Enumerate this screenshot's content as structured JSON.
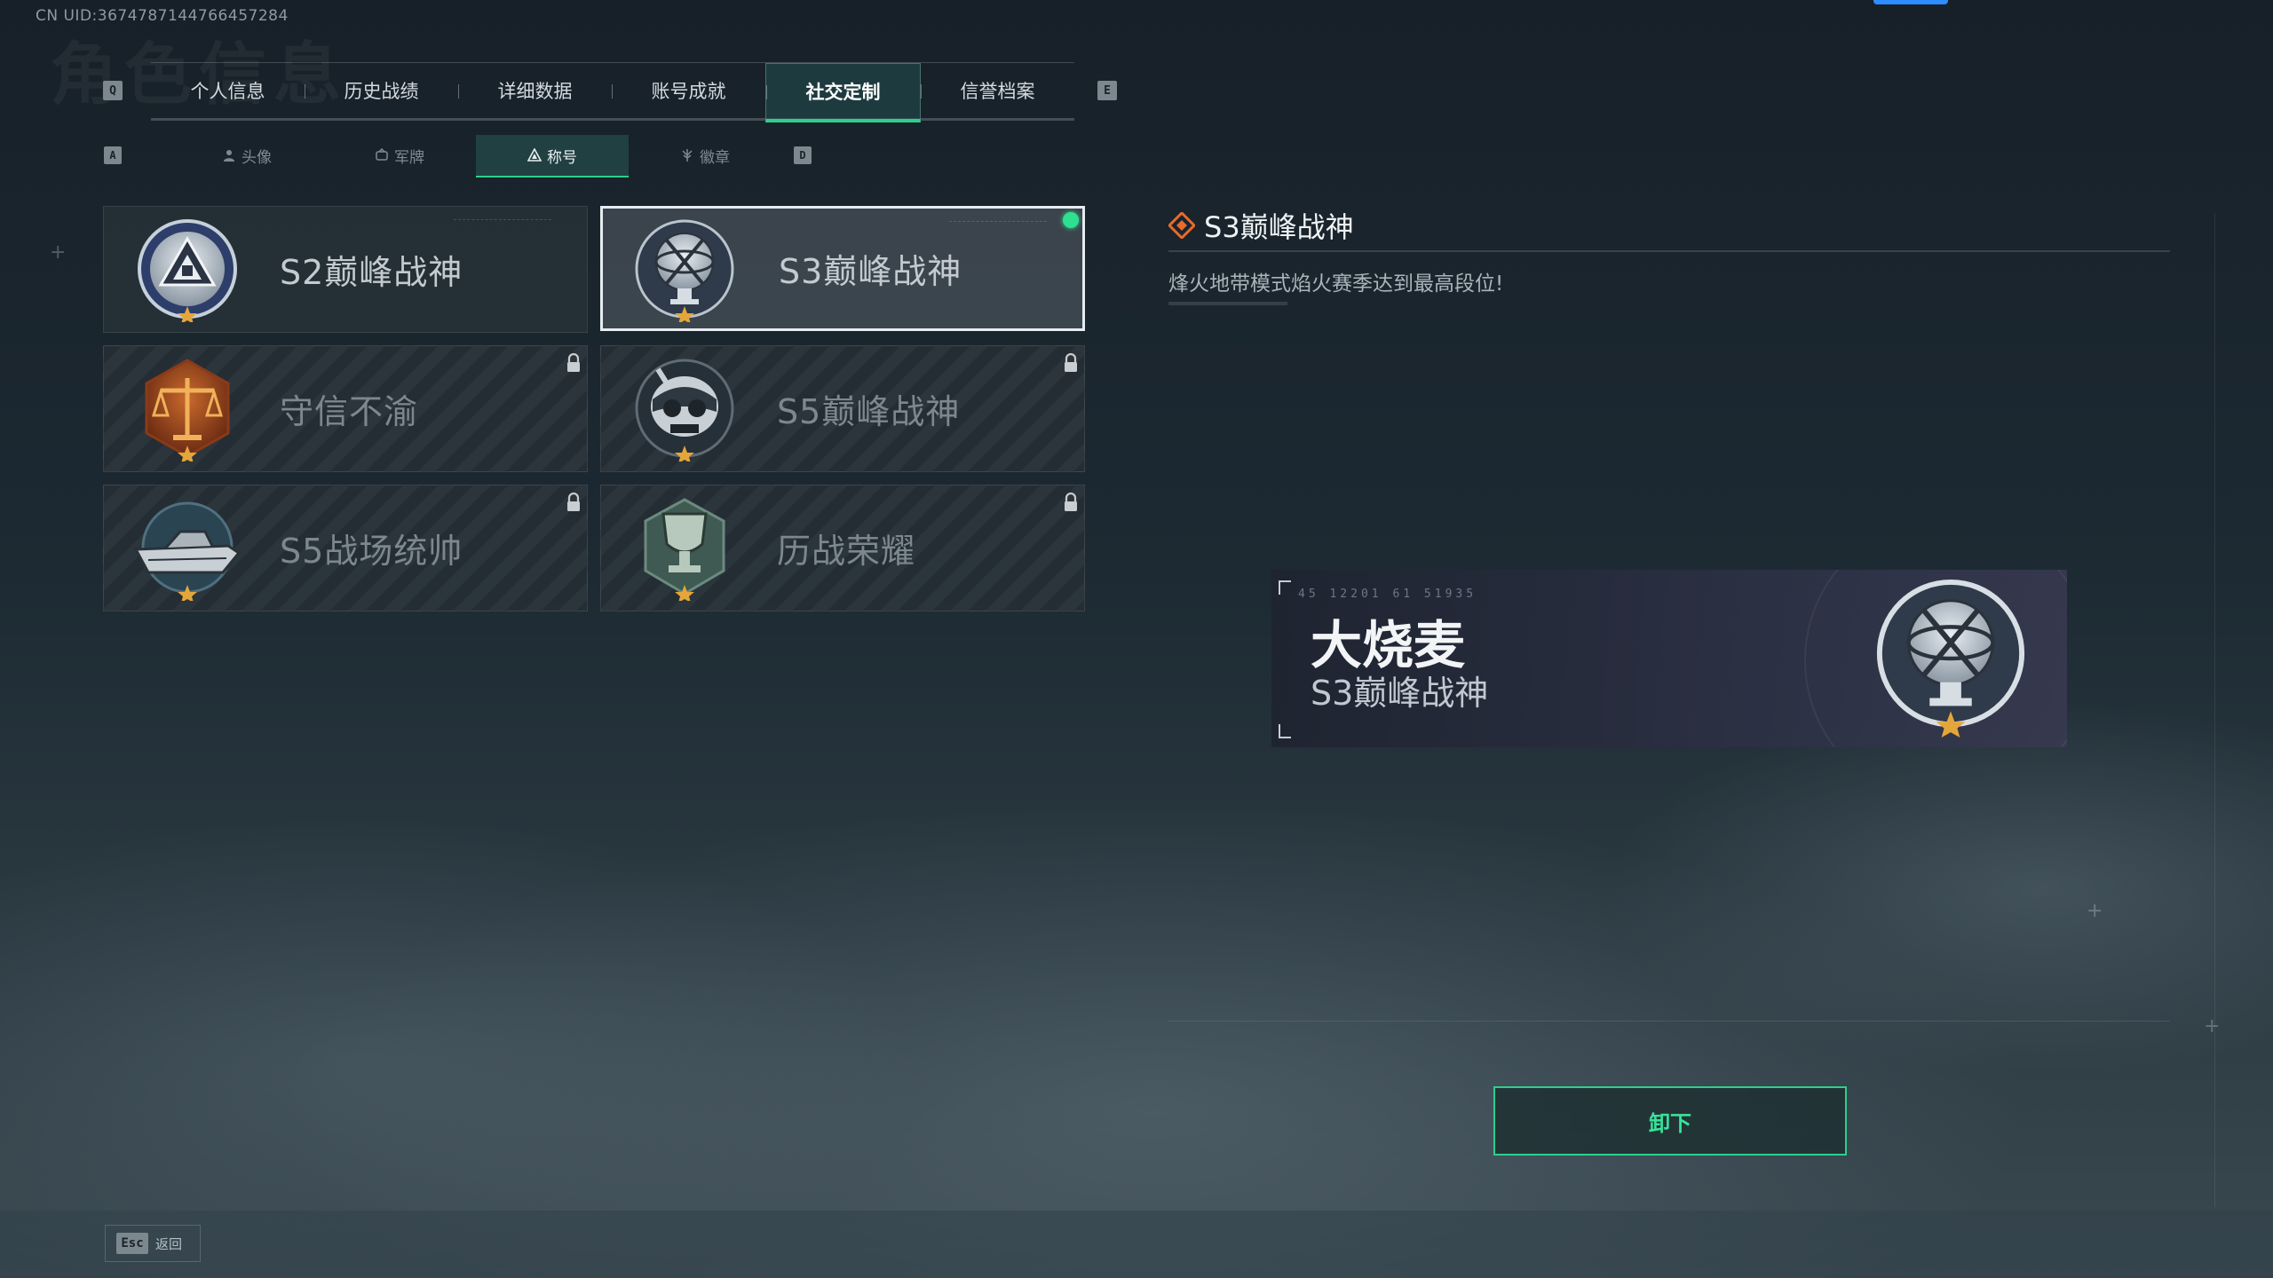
{
  "uid": "CN UID:36747871447664572​84",
  "page_title_bg": "角色信息",
  "tabs": {
    "key_prev": "Q",
    "key_next": "E",
    "items": [
      {
        "label": "个人信息"
      },
      {
        "label": "历史战绩"
      },
      {
        "label": "详细数据"
      },
      {
        "label": "账号成就"
      },
      {
        "label": "社交定制",
        "active": true
      },
      {
        "label": "信誉档案"
      }
    ]
  },
  "subtabs": {
    "key_prev": "A",
    "key_next": "D",
    "items": [
      {
        "label": "头像",
        "icon": "person-icon"
      },
      {
        "label": "军牌",
        "icon": "dogtag-icon"
      },
      {
        "label": "称号",
        "icon": "title-icon",
        "active": true
      },
      {
        "label": "徽章",
        "icon": "emblem-icon"
      }
    ]
  },
  "titles": [
    {
      "name": "S2巅峰战神",
      "badge": "s2-peak-badge-icon",
      "locked": false
    },
    {
      "name": "S3巅峰战神",
      "badge": "s3-peak-badge-icon",
      "locked": false,
      "selected": true,
      "equipped": true
    },
    {
      "name": "守信不渝",
      "badge": "scales-badge-icon",
      "locked": true
    },
    {
      "name": "S5巅峰战神",
      "badge": "skull-badge-icon",
      "locked": true
    },
    {
      "name": "S5战场统帅",
      "badge": "boat-badge-icon",
      "locked": true
    },
    {
      "name": "历战荣耀",
      "badge": "trophy-badge-icon",
      "locked": true
    }
  ],
  "detail": {
    "title": "S3巅峰战神",
    "description": "烽火地带模式焰火赛季达到最高段位!"
  },
  "nameplate": {
    "code": "45 12201  61 51935",
    "player_name": "大烧麦",
    "title": "S3巅峰战神"
  },
  "unequip_label": "卸下",
  "footer": {
    "key": "Esc",
    "label": "返回"
  },
  "colors": {
    "accent_green": "#2ecf8c",
    "equipped_dot": "#2ee08f",
    "top_indicator": "#2d8cff"
  }
}
